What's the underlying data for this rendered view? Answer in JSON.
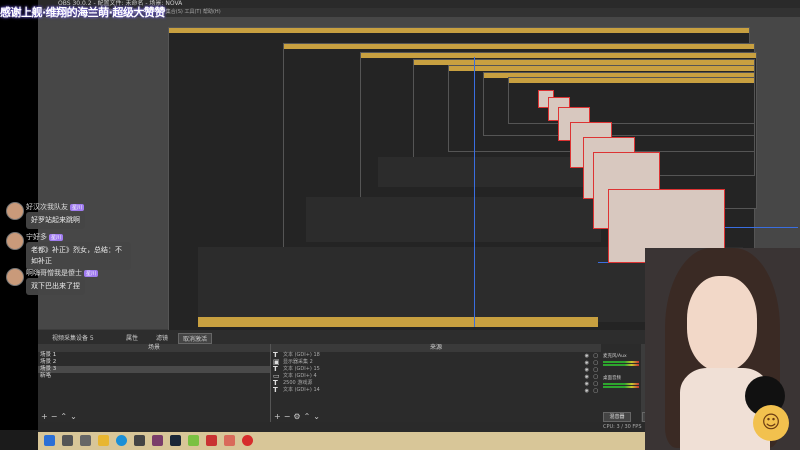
{
  "overlay": {
    "text": "感谢上舰·维翔的海兰萌·超级大赞赞"
  },
  "chat": {
    "messages": [
      {
        "name": "好汉次我队友",
        "badge": "星川",
        "text": "好罗站起来跳啊"
      },
      {
        "name": "宁好多",
        "badge": "星川",
        "text": "老都》补正》烈女，总结：不如补正"
      },
      {
        "name": "啊嗨哥憎我是傻士",
        "badge": "星川",
        "text": "双下巴出来了捏"
      }
    ]
  },
  "obs": {
    "title": "OBS 30.0.2 - 配置文件: 未命名 - 场景: NOVA",
    "menu": "文件(F)  编辑(E)  视图(V)  停靠窗口(D)  配置文件(P)  场景集合(S)  工具(T)  帮助(H)",
    "dock_bar": {
      "source_name": "视频采集设备 5",
      "properties": "属性",
      "filters": "滤镜",
      "deactivate": "取消激活"
    },
    "scenes": {
      "header": "场景",
      "items": [
        "场景 1",
        "场景 2",
        "场景 3",
        "新咯"
      ]
    },
    "sources": {
      "header": "来源",
      "items": [
        {
          "icon": "T",
          "label": "文本 (GDI+) 18"
        },
        {
          "icon": "▣",
          "label": "显示器采集 2"
        },
        {
          "icon": "T",
          "label": "文本 (GDI+) 15"
        },
        {
          "icon": "▭",
          "label": "文本 (GDI+) 4"
        },
        {
          "icon": "T",
          "label": "2500 游戏源"
        },
        {
          "icon": "T",
          "label": "文本 (GDI+) 14"
        }
      ]
    },
    "mixer": {
      "labels": [
        "麦克风/Aux",
        "桌面音频"
      ]
    },
    "controls": {
      "mixer_tab": "混音器",
      "transition_tab": "转"
    },
    "status": "CPU: 3 / 30 FPS"
  },
  "taskbar": {
    "icons": [
      "windows-icon",
      "search-icon",
      "task-view-icon",
      "explorer-icon",
      "edge-icon",
      "obs-icon",
      "app-icon",
      "steam-icon",
      "android-icon",
      "app-red-icon",
      "photo-icon",
      "netease-icon"
    ]
  },
  "colors": {
    "overlay_glow": "#6a5acd",
    "badge": "#a07cf0",
    "title_bar_gold": "#c8a040",
    "taskbar": "#d8c698",
    "frame_border_red": "#dd3333"
  }
}
